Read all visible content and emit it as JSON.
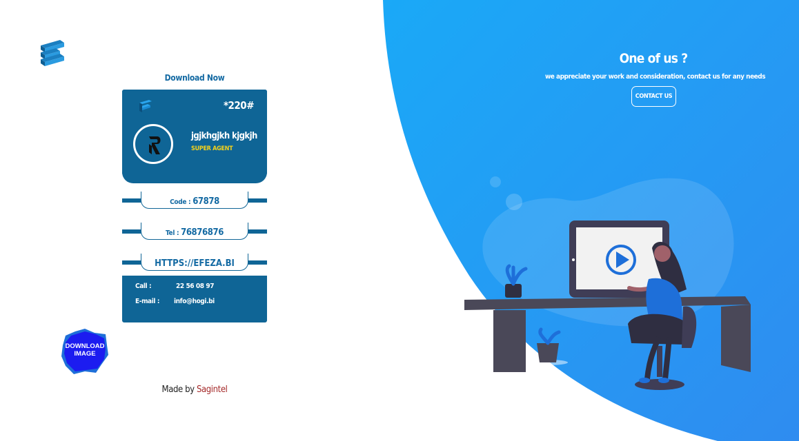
{
  "brand": {
    "accent": "#0f6596",
    "hero_gradient": [
      "#1aa9f7",
      "#2f8cf0"
    ]
  },
  "left": {
    "download_now": "Download Now",
    "card": {
      "ussd": "*220#",
      "name": "jgjkhgjkh kjgkjh",
      "role": "SUPER AGENT",
      "code_label": "Code : ",
      "code_value": "67878",
      "tel_label": "Tel : ",
      "tel_value": "76876876",
      "url": "HTTPS://EFEZA.BI",
      "call_label": "Call :",
      "call_value": "22 56 08 97",
      "email_label": "E-mail :",
      "email_value": "info@hogi.bi"
    },
    "download_image": "DOWNLOAD IMAGE",
    "made_by_prefix": "Made by ",
    "made_by_brand": "Sagintel"
  },
  "right": {
    "title": "One of us ?",
    "subtitle": "we appreciate your work and consideration, contact us for any needs",
    "contact_button": "CONTACT US"
  },
  "icons": {
    "logo": "efeza-logo-icon",
    "avatar": "r-brand-icon",
    "illustration": "woman-at-desk-video-illustration"
  }
}
